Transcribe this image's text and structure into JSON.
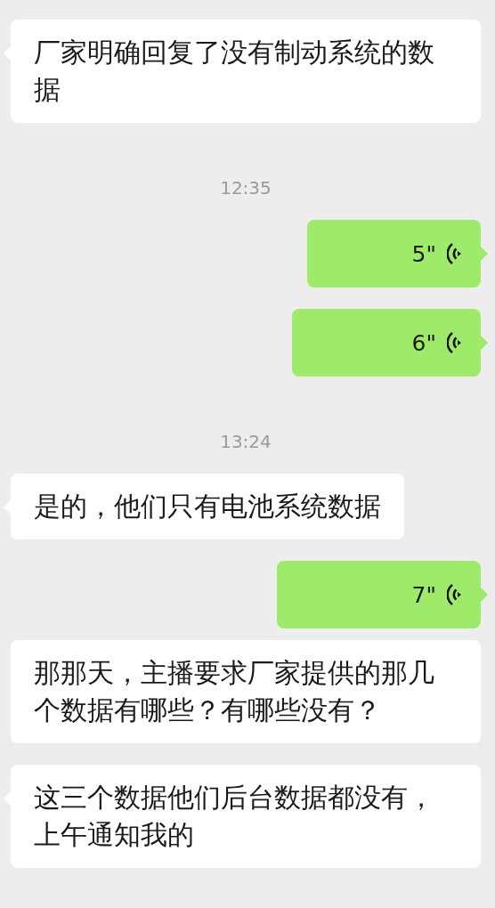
{
  "messages": [
    {
      "kind": "text",
      "outgoing": false,
      "text": "厂家明确回复了没有制动系统的数据",
      "tail": true
    },
    {
      "kind": "time",
      "text": "12:35"
    },
    {
      "kind": "voice",
      "outgoing": true,
      "duration": "5\"",
      "tail": true
    },
    {
      "kind": "voice",
      "outgoing": true,
      "duration": "6\"",
      "tail": true
    },
    {
      "kind": "time",
      "text": "13:24"
    },
    {
      "kind": "text",
      "outgoing": false,
      "text": "是的，他们只有电池系统数据",
      "tail": true
    },
    {
      "kind": "voice",
      "outgoing": true,
      "duration": "7\"",
      "tail": true
    },
    {
      "kind": "text",
      "outgoing": false,
      "text": "那那天，主播要求厂家提供的那几个数据有哪些？有哪些没有？",
      "tail": false
    },
    {
      "kind": "text",
      "outgoing": false,
      "text": "这三个数据他们后台数据都没有，上午通知我的",
      "tail": true
    }
  ]
}
